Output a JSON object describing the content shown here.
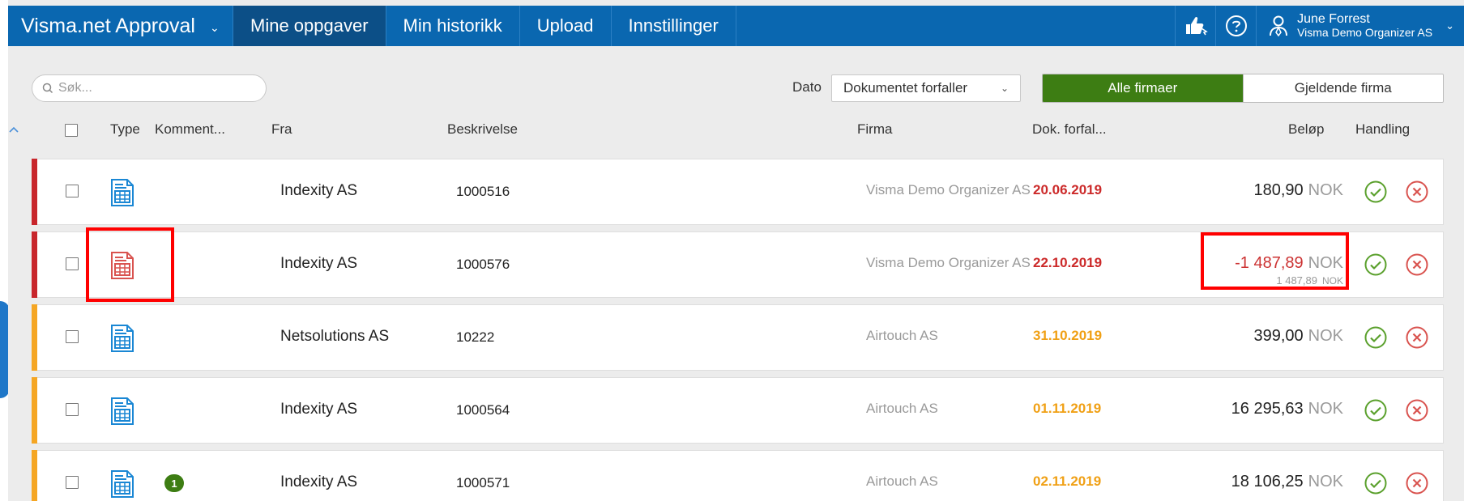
{
  "app": {
    "title": "Visma.net Approval"
  },
  "nav": {
    "tabs": [
      {
        "label": "Mine oppgaver",
        "active": true
      },
      {
        "label": "Min historikk",
        "active": false
      },
      {
        "label": "Upload",
        "active": false
      },
      {
        "label": "Innstillinger",
        "active": false
      }
    ],
    "icons": [
      "thumbs-up-icon",
      "help-icon",
      "user-icon"
    ]
  },
  "user": {
    "name": "June Forrest",
    "org": "Visma Demo Organizer AS"
  },
  "toolbar": {
    "search_placeholder": "Søk...",
    "date_label": "Dato",
    "date_value": "Dokumentet forfaller",
    "filter_all": "Alle firmaer",
    "filter_current": "Gjeldende firma"
  },
  "columns": {
    "type": "Type",
    "comment": "Komment...",
    "from": "Fra",
    "description": "Beskrivelse",
    "company": "Firma",
    "due": "Dok. forfal...",
    "amount": "Beløp",
    "action": "Handling"
  },
  "rows": [
    {
      "from": "Indexity AS",
      "description": "1000516",
      "company": "Visma Demo Organizer AS",
      "due": "20.06.2019",
      "amount": "180,90",
      "currency": "NOK"
    },
    {
      "from": "Indexity AS",
      "description": "1000576",
      "company": "Visma Demo Organizer AS",
      "due": "22.10.2019",
      "amount": "-1 487,89",
      "currency": "NOK",
      "sub_amount": "1 487,89",
      "sub_currency": "NOK"
    },
    {
      "from": "Netsolutions AS",
      "description": "10222",
      "company": "Airtouch AS",
      "due": "31.10.2019",
      "amount": "399,00",
      "currency": "NOK"
    },
    {
      "from": "Indexity AS",
      "description": "1000564",
      "company": "Airtouch AS",
      "due": "01.11.2019",
      "amount": "16 295,63",
      "currency": "NOK"
    },
    {
      "from": "Indexity AS",
      "description": "1000571",
      "company": "Airtouch AS",
      "due": "02.11.2019",
      "amount": "18 106,25",
      "currency": "NOK",
      "comments": "1"
    }
  ],
  "colors": {
    "nav_bg": "#0a67b0",
    "nav_active": "#0c4f87",
    "accent_green": "#3d7d13",
    "overdue_red": "#cc2a2a",
    "due_orange": "#f0a015",
    "stripe_red": "#c8262c",
    "stripe_orange": "#f5a623",
    "approve_green": "#5aa02c",
    "reject_red": "#d9534f",
    "highlight_box": "#ff0000"
  }
}
